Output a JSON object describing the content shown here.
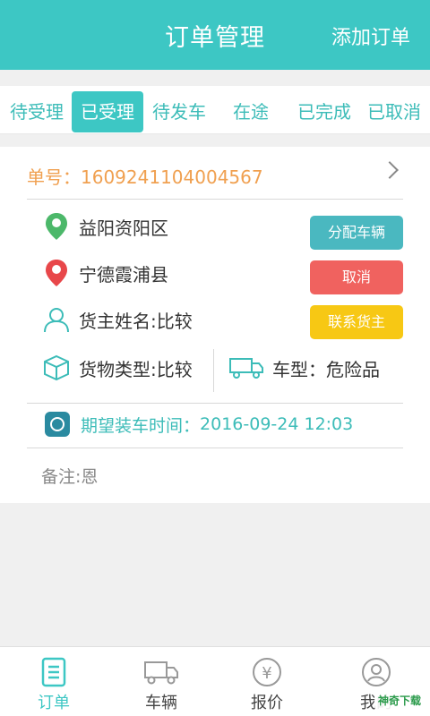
{
  "header": {
    "title": "订单管理",
    "add_label": "添加订单"
  },
  "tabs": [
    {
      "label": "待受理",
      "active": false
    },
    {
      "label": "已受理",
      "active": true
    },
    {
      "label": "待发车",
      "active": false
    },
    {
      "label": "在途",
      "active": false
    },
    {
      "label": "已完成",
      "active": false
    },
    {
      "label": "已取消",
      "active": false
    }
  ],
  "order": {
    "number_label": "单号：",
    "number": "1609241104004567",
    "origin": "益阳资阳区",
    "destination": "宁德霞浦县",
    "owner_name": "货主姓名:比较",
    "cargo_type": "货物类型:比较",
    "vehicle_type": "车型：危险品",
    "expected_time_label": "期望装车时间：",
    "expected_time": "2016-09-24 12:03",
    "note": "备注:恩"
  },
  "actions": {
    "assign": "分配车辆",
    "cancel": "取消",
    "contact": "联系货主"
  },
  "bottom_nav": [
    {
      "label": "订单",
      "icon": "document-icon"
    },
    {
      "label": "车辆",
      "icon": "truck-icon"
    },
    {
      "label": "报价",
      "icon": "yen-icon"
    },
    {
      "label": "我的",
      "icon": "user-icon"
    }
  ],
  "watermark": "神奇下载",
  "colors": {
    "primary": "#3dc7c4",
    "order_number": "#f0a050",
    "cancel": "#f0625f",
    "contact": "#f7c814",
    "assign": "#4ab8c0"
  }
}
